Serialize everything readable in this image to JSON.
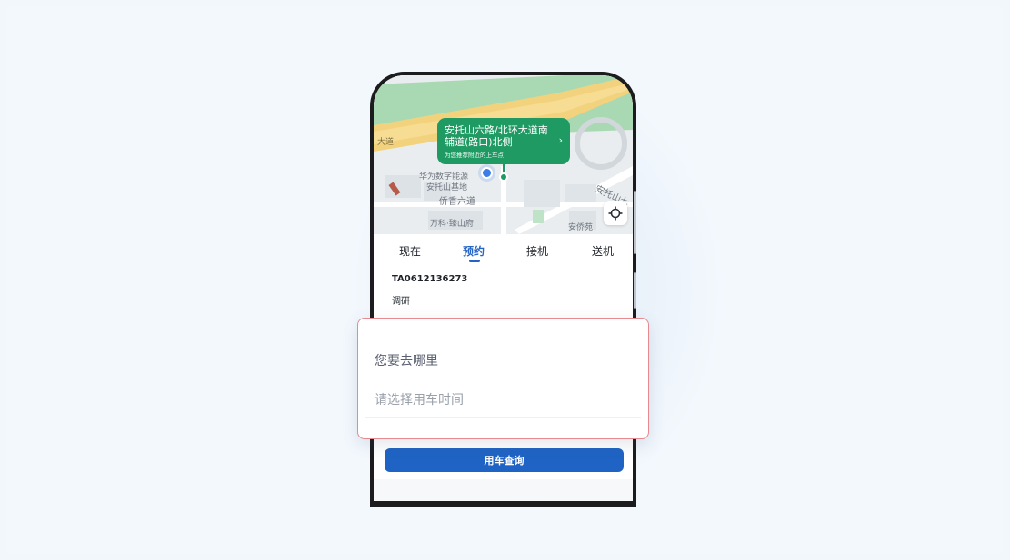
{
  "map": {
    "road_label": "大道",
    "pickup_bubble": {
      "title": "安托山六路/北环大道南辅道(路口)北侧",
      "subtitle": "为您推荐附近的上车点"
    },
    "labels": {
      "huawei": "华为数字能源",
      "anto_base": "安托山基地",
      "qiaoxiang_road": "侨香六道",
      "vanke": "万科·臻山府",
      "anqiao": "安侨苑",
      "anto_road": "安托山七"
    }
  },
  "tabs": [
    {
      "label": "现在",
      "active": false
    },
    {
      "label": "预约",
      "active": true
    },
    {
      "label": "接机",
      "active": false
    },
    {
      "label": "送机",
      "active": false
    }
  ],
  "order": {
    "id": "TA0612136273",
    "tag": "调研"
  },
  "form": {
    "destination_placeholder": "您要去哪里",
    "time_placeholder": "请选择用车时间"
  },
  "actions": {
    "query_label": "用车查询"
  },
  "colors": {
    "brand_blue": "#1f64c4",
    "tab_active": "#2563c7",
    "pickup_green": "#1f9a63",
    "location_blue": "#3b7ee8",
    "highlight_border": "#e68a8f"
  },
  "icons": {
    "my_location": "blue-dot",
    "pickup": "green-pin",
    "locate_button": "crosshair-icon",
    "bubble_arrow": "chevron-right-icon"
  }
}
